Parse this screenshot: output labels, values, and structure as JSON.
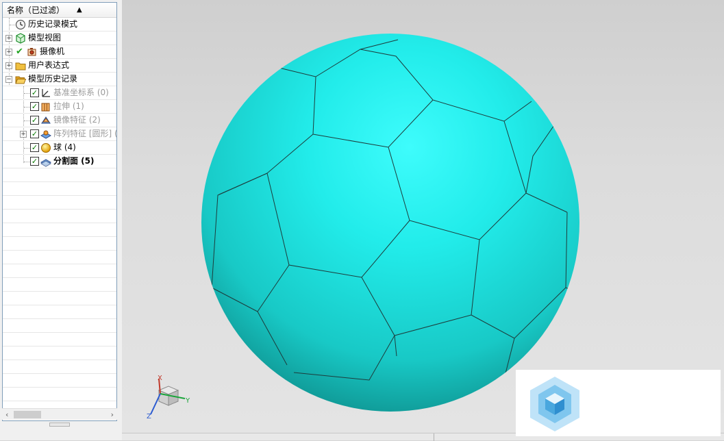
{
  "navigator": {
    "header": "名称（已过滤）",
    "sort_icon": "sort-ascending-icon",
    "items": [
      {
        "label": "历史记录模式",
        "icon": "clock-icon"
      },
      {
        "label": "模型视图",
        "icon": "model-views-icon"
      },
      {
        "label": "摄像机",
        "icon": "camera-icon"
      },
      {
        "label": "用户表达式",
        "icon": "folder-icon"
      },
      {
        "label": "模型历史记录",
        "icon": "folder-open-icon"
      },
      {
        "label": "基准坐标系 (0)",
        "icon": "datum-csys-icon"
      },
      {
        "label": "拉伸 (1)",
        "icon": "extrude-icon"
      },
      {
        "label": "镜像特征 (2)",
        "icon": "mirror-feature-icon"
      },
      {
        "label": "阵列特征 [圆形] (",
        "icon": "pattern-feature-icon"
      },
      {
        "label": "球 (4)",
        "icon": "sphere-icon"
      },
      {
        "label": "分割面 (5)",
        "icon": "divide-face-icon"
      }
    ]
  },
  "triad": {
    "x": "X",
    "y": "Y",
    "z": "Z"
  },
  "colors": {
    "ball": "#1ee8e6",
    "seam": "#1d3b3b",
    "background": "#d8d8d8"
  }
}
